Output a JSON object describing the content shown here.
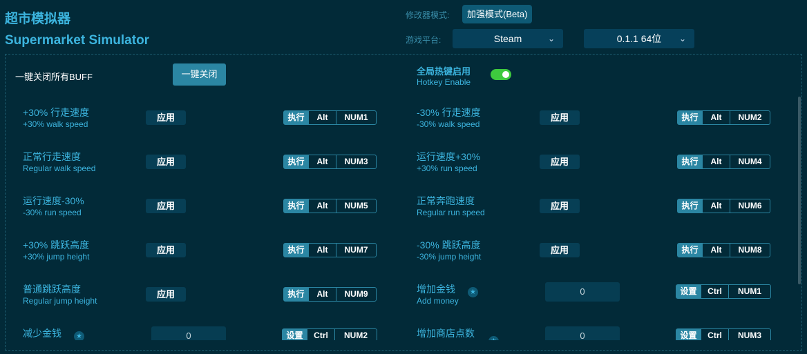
{
  "title_cn": "超市模拟器",
  "title_en": "Supermarket Simulator",
  "mode_label": "修改器模式:",
  "mode_value": "加强模式(Beta)",
  "platform_label": "游戏平台:",
  "platform_value": "Steam",
  "version_value": "0.1.1 64位",
  "close_all_label": "一键关闭所有BUFF",
  "close_all_button": "一键关闭",
  "hotkey_cn": "全局热键启用",
  "hotkey_en": "Hotkey Enable",
  "hotkey_enabled": true,
  "apply_label": "应用",
  "cheats": [
    {
      "cn": "+30% 行走速度",
      "en": "+30% walk speed",
      "type": "apply",
      "keys": [
        "执行",
        "Alt",
        "NUM1"
      ]
    },
    {
      "cn": "-30% 行走速度",
      "en": "-30% walk speed",
      "type": "apply",
      "keys": [
        "执行",
        "Alt",
        "NUM2"
      ]
    },
    {
      "cn": "正常行走速度",
      "en": "Regular walk speed",
      "type": "apply",
      "keys": [
        "执行",
        "Alt",
        "NUM3"
      ]
    },
    {
      "cn": "运行速度+30%",
      "en": "+30% run speed",
      "type": "apply",
      "keys": [
        "执行",
        "Alt",
        "NUM4"
      ]
    },
    {
      "cn": "运行速度-30%",
      "en": "-30% run speed",
      "type": "apply",
      "keys": [
        "执行",
        "Alt",
        "NUM5"
      ]
    },
    {
      "cn": "正常奔跑速度",
      "en": "Regular run speed",
      "type": "apply",
      "keys": [
        "执行",
        "Alt",
        "NUM6"
      ]
    },
    {
      "cn": "+30% 跳跃高度",
      "en": "+30% jump height",
      "type": "apply",
      "keys": [
        "执行",
        "Alt",
        "NUM7"
      ]
    },
    {
      "cn": "-30% 跳跃高度",
      "en": "-30% jump height",
      "type": "apply",
      "keys": [
        "执行",
        "Alt",
        "NUM8"
      ]
    },
    {
      "cn": "普通跳跃高度",
      "en": "Regular jump height",
      "type": "apply",
      "keys": [
        "执行",
        "Alt",
        "NUM9"
      ]
    },
    {
      "cn": "增加金钱",
      "en": "Add money",
      "type": "input",
      "value": "0",
      "keys": [
        "设置",
        "Ctrl",
        "NUM1"
      ]
    },
    {
      "cn": "减少金钱",
      "en": "",
      "type": "input",
      "value": "0",
      "keys": [
        "设置",
        "Ctrl",
        "NUM2"
      ]
    },
    {
      "cn": "增加商店点数",
      "en": "",
      "type": "input",
      "value": "0",
      "keys": [
        "设置",
        "Ctrl",
        "NUM3"
      ]
    }
  ]
}
